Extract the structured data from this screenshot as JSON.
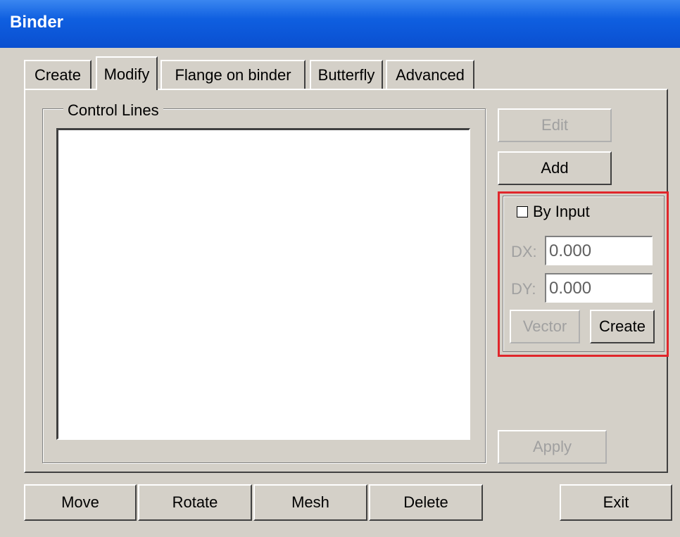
{
  "window": {
    "title": "Binder"
  },
  "tabs": [
    {
      "label": "Create",
      "active": false
    },
    {
      "label": "Modify",
      "active": true
    },
    {
      "label": "Flange on binder",
      "active": false
    },
    {
      "label": "Butterfly",
      "active": false
    },
    {
      "label": "Advanced",
      "active": false
    }
  ],
  "control_lines": {
    "group_label": "Control Lines",
    "items": []
  },
  "buttons": {
    "edit": "Edit",
    "add": "Add",
    "apply": "Apply",
    "vector": "Vector",
    "create": "Create"
  },
  "by_input": {
    "checkbox_label": "By Input",
    "checked": false,
    "dx_label": "DX:",
    "dx_value": "0.000",
    "dy_label": "DY:",
    "dy_value": "0.000"
  },
  "footer": {
    "move": "Move",
    "rotate": "Rotate",
    "mesh": "Mesh",
    "delete": "Delete",
    "exit": "Exit"
  },
  "colors": {
    "titlebar": "#0a4fd0",
    "background": "#d4d0c8",
    "highlight_border": "#e0262b",
    "disabled_text": "#a0a0a0"
  }
}
